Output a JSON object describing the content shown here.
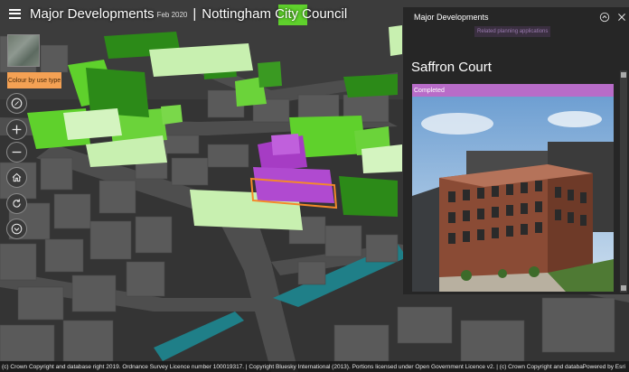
{
  "header": {
    "title": "Major Developments",
    "date": "Feb 2020",
    "separator": "|",
    "organization": "Nottingham City Council"
  },
  "tools": {
    "colour_button_label": "Colour by use type",
    "buttons": [
      "compass-icon",
      "zoom-in-icon",
      "zoom-out-icon",
      "home-icon",
      "rotate-icon",
      "chevron-down-icon"
    ]
  },
  "panel": {
    "title": "Major Developments",
    "related_link": "Related planning applications",
    "feature_title": "Saffron Court",
    "status": "Completed",
    "accent_color": "#b86cc8"
  },
  "attribution": {
    "text": "(c) Crown Copyright and database right 2019. Ordnance Survey Licence number 100019317. | Copyright Bluesky International (2013). Portions licensed under Open Government Licence v2. | (c) Crown Copyright and databas...",
    "powered_by": "Powered by Esri"
  },
  "colors": {
    "green_bright": "#5fd12c",
    "green_dark": "#2c8a18",
    "green_pale": "#c8f0b0",
    "purple": "#a63cc4",
    "selection": "#f4892a",
    "water": "#1f7f88"
  }
}
